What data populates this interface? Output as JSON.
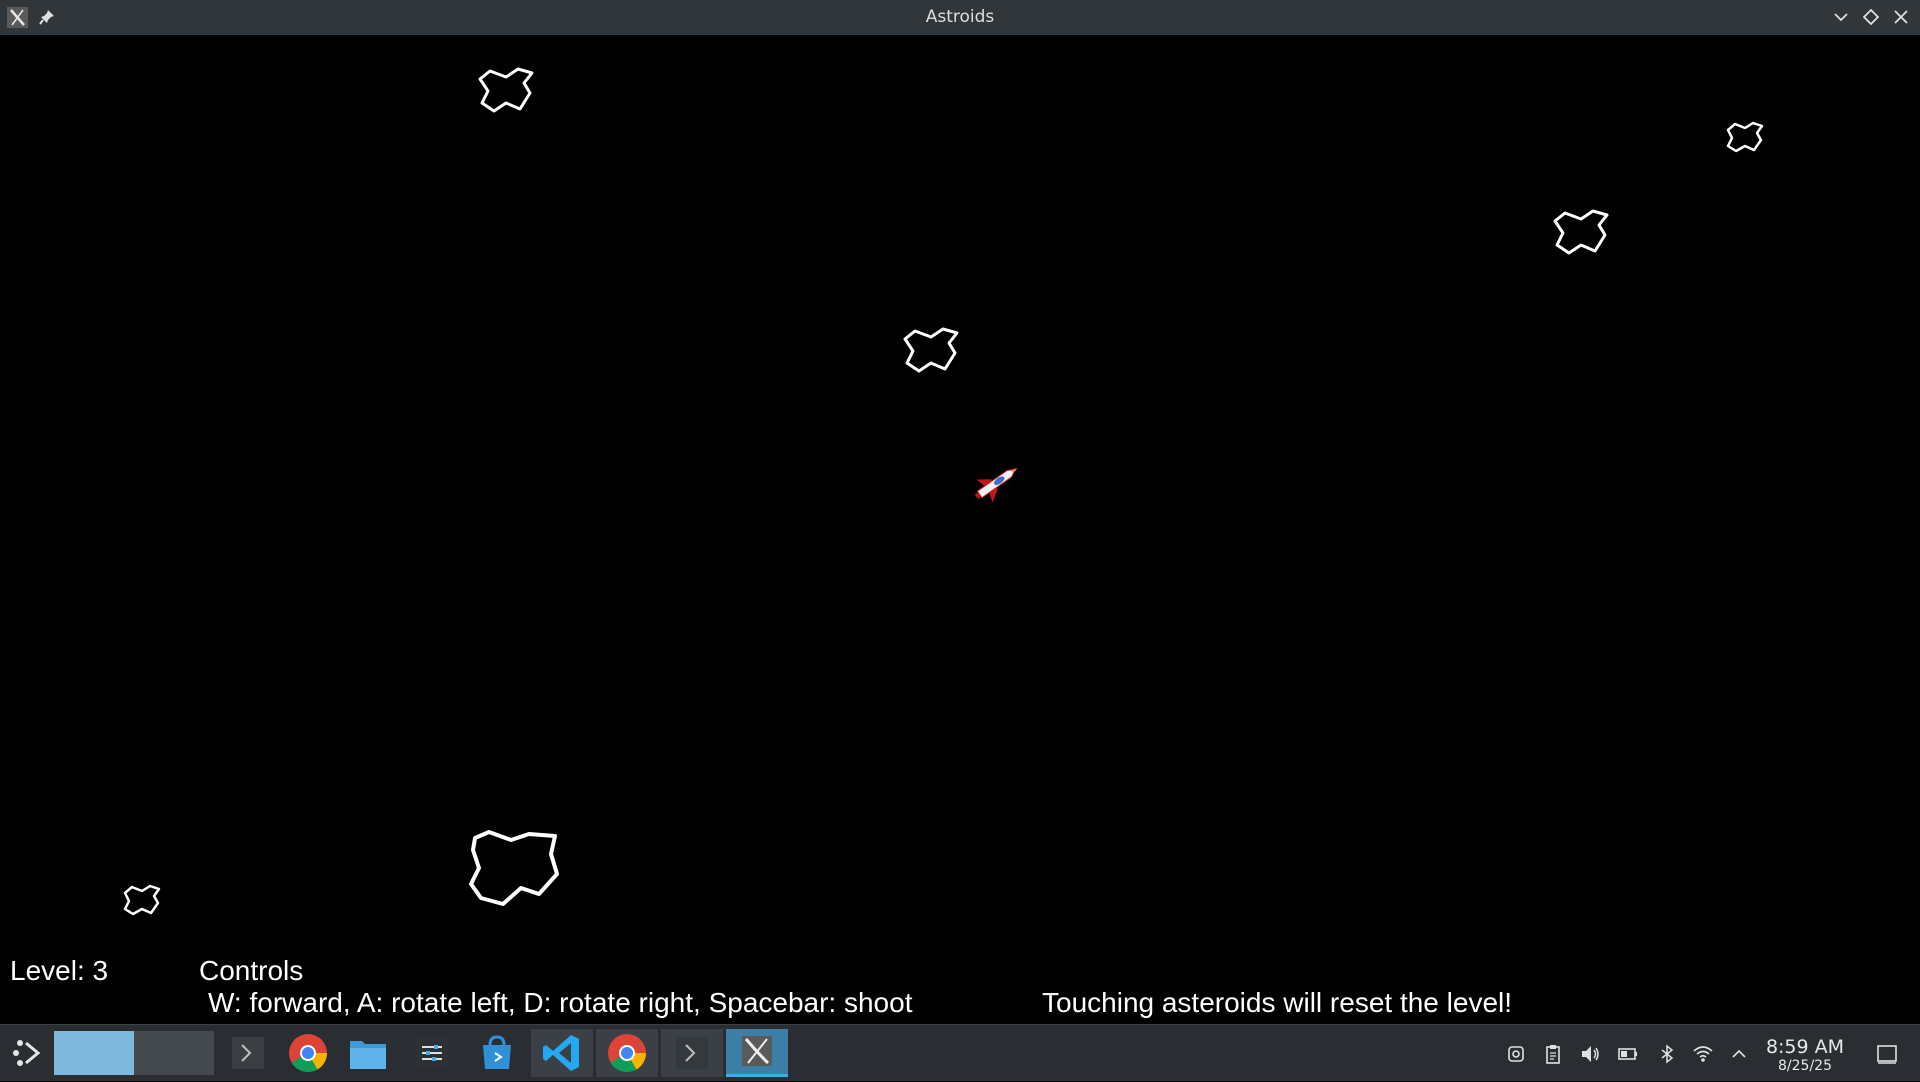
{
  "window": {
    "title": "Astroids"
  },
  "hud": {
    "level": "Level: 3",
    "controls_heading": "Controls",
    "controls_text": "W: forward, A: rotate left, D: rotate right, Spacebar: shoot",
    "warning": "Touching asteroids will reset the level!"
  },
  "taskbar": {
    "items": [
      {
        "icon": "application-launcher-icon"
      },
      {
        "icon": "virtual-desktop-pager"
      },
      {
        "icon": "terminal-icon"
      },
      {
        "icon": "chrome-icon"
      },
      {
        "icon": "file-manager-icon"
      },
      {
        "icon": "system-settings-icon"
      },
      {
        "icon": "software-store-icon"
      },
      {
        "icon": "vscode-icon"
      },
      {
        "icon": "chrome-icon"
      },
      {
        "icon": "terminal-icon"
      },
      {
        "icon": "x-window-app-icon"
      }
    ],
    "clock": {
      "time": "8:59 AM",
      "date": "8/25/25"
    }
  },
  "colors": {
    "titlebar": "#31363b",
    "game_background": "#000000",
    "asteroid_stroke": "#ffffff",
    "taskbar": "#2a2e32",
    "active_task": "#3daee9"
  }
}
